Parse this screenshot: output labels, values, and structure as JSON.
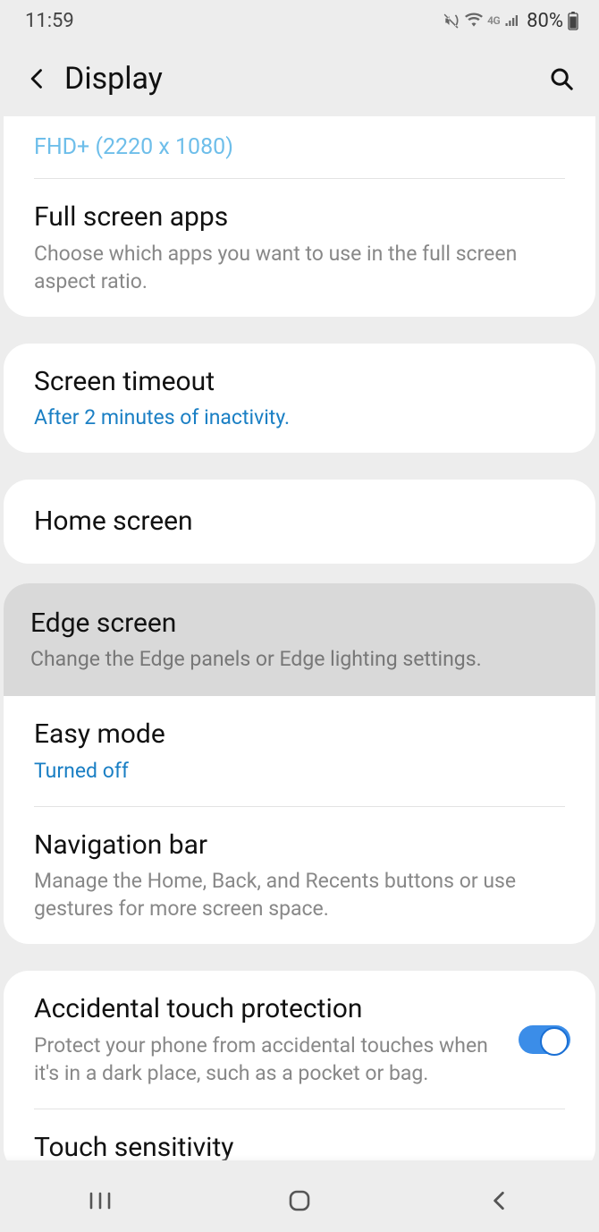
{
  "status": {
    "time": "11:59",
    "battery_pct": "80%"
  },
  "header": {
    "title": "Display"
  },
  "resolution": "FHD+ (2220 x 1080)",
  "fullscreen": {
    "title": "Full screen apps",
    "sub": "Choose which apps you want to use in the full screen aspect ratio."
  },
  "screen_timeout": {
    "title": "Screen timeout",
    "sub": "After 2 minutes of inactivity."
  },
  "home_screen": {
    "title": "Home screen"
  },
  "edge_screen": {
    "title": "Edge screen",
    "sub": "Change the Edge panels or Edge lighting settings."
  },
  "easy_mode": {
    "title": "Easy mode",
    "sub": "Turned off"
  },
  "nav_bar": {
    "title": "Navigation bar",
    "sub": "Manage the Home, Back, and Recents buttons or use gestures for more screen space."
  },
  "accidental": {
    "title": "Accidental touch protection",
    "sub": "Protect your phone from accidental touches when it's in a dark place, such as a pocket or bag.",
    "on": true
  },
  "touch_sensitivity": {
    "title": "Touch sensitivity"
  }
}
